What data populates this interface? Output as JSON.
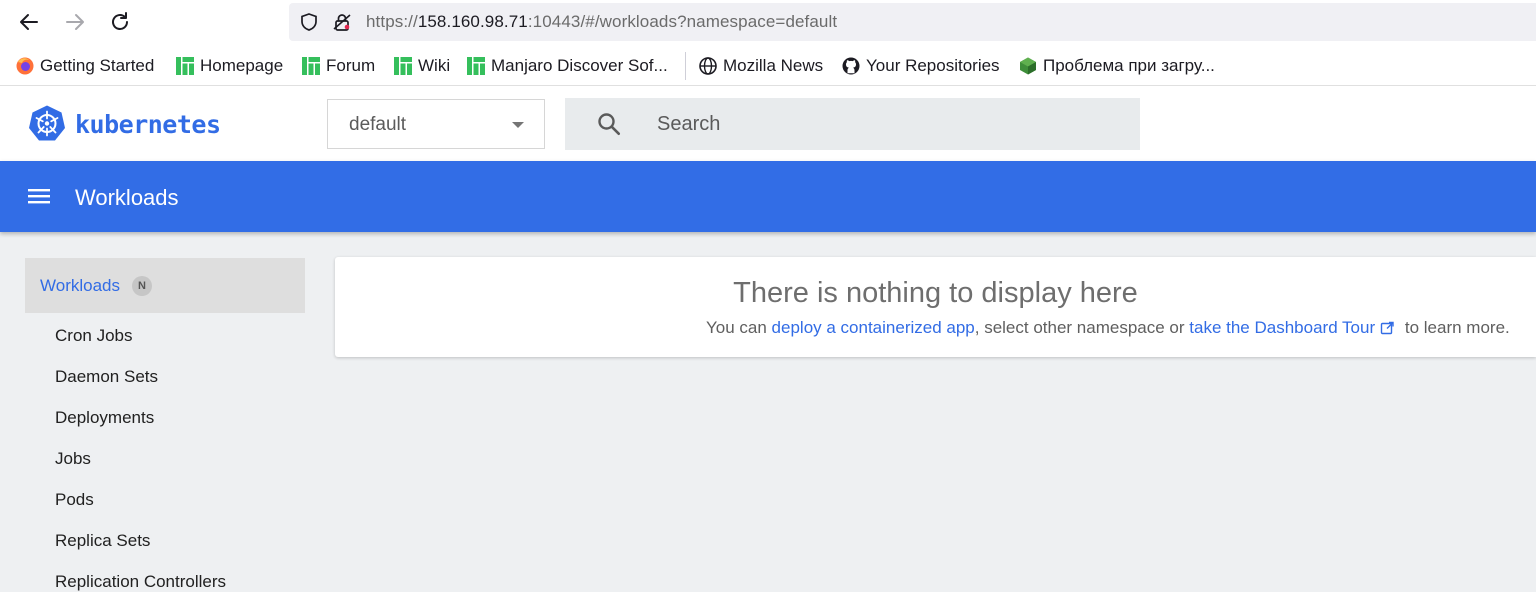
{
  "browser": {
    "url_prefix": "https://",
    "url_host": "158.160.98.71",
    "url_rest": ":10443/#/workloads?namespace=default",
    "bookmarks": [
      {
        "label": "Getting Started",
        "icon": "firefox-icon"
      },
      {
        "label": "Homepage",
        "icon": "manjaro-icon"
      },
      {
        "label": "Forum",
        "icon": "manjaro-icon"
      },
      {
        "label": "Wiki",
        "icon": "manjaro-icon"
      },
      {
        "label": "Manjaro Discover Sof...",
        "icon": "manjaro-icon"
      },
      {
        "label": "Mozilla News",
        "icon": "globe-icon"
      },
      {
        "label": "Your Repositories",
        "icon": "github-icon"
      },
      {
        "label": "Проблема при загру...",
        "icon": "cube-icon"
      }
    ]
  },
  "header": {
    "brand": "kubernetes",
    "namespace": "default",
    "search_placeholder": "Search"
  },
  "toolbar": {
    "title": "Workloads"
  },
  "sidebar": {
    "section": "Workloads",
    "badge": "N",
    "items": [
      "Cron Jobs",
      "Daemon Sets",
      "Deployments",
      "Jobs",
      "Pods",
      "Replica Sets",
      "Replication Controllers"
    ]
  },
  "empty_state": {
    "title": "There is nothing to display here",
    "text_1": "You can ",
    "link_1": "deploy a containerized app",
    "text_2": ", select other namespace or ",
    "link_2": "take the Dashboard Tour",
    "text_3": " to learn more."
  },
  "colors": {
    "accent": "#326ce5",
    "toolbar": "#326de6",
    "manjaro": "#35bf5c"
  }
}
